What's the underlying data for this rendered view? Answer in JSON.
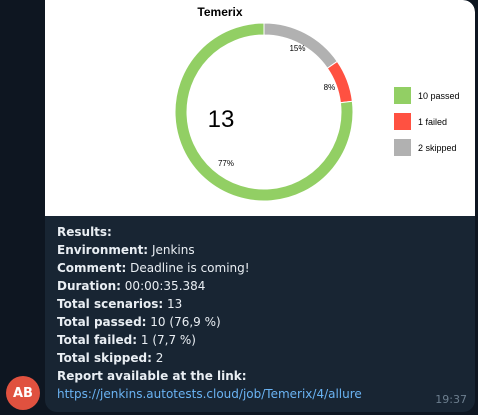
{
  "chart_data": {
    "type": "pie",
    "title": "Temerix",
    "center_label": "13",
    "labels": [
      "10 passed",
      "1 failed",
      "2 skipped"
    ],
    "values": [
      10,
      1,
      2
    ],
    "percent_labels": [
      "77%",
      "8%",
      "15%"
    ],
    "colors": [
      "#92cf64",
      "#ff5141",
      "#b1b1b1"
    ],
    "legend_position": "right"
  },
  "message": {
    "results_label": "Results:",
    "lines": [
      {
        "label": "Environment:",
        "value": "Jenkins"
      },
      {
        "label": "Comment:",
        "value": "Deadline is coming!"
      },
      {
        "label": "Duration:",
        "value": "00:00:35.384"
      },
      {
        "label": "Total scenarios:",
        "value": "13"
      },
      {
        "label": "Total passed:",
        "value": "10 (76,9 %)"
      },
      {
        "label": "Total failed:",
        "value": "1 (7,7 %)"
      },
      {
        "label": "Total skipped:",
        "value": "2"
      }
    ],
    "report_label": "Report available at the link:",
    "report_url": "https://jenkins.autotests.cloud/job/Temerix/4/allure",
    "time": "19:37"
  },
  "avatar": {
    "initials": "AB",
    "color": "#e0513f"
  }
}
